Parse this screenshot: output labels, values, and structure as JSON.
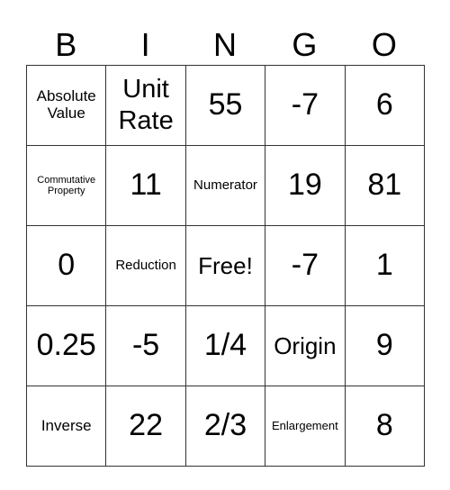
{
  "header": [
    "B",
    "I",
    "N",
    "G",
    "O"
  ],
  "rows": [
    [
      {
        "text": "Absolute Value",
        "size": "s-sm"
      },
      {
        "text": "Unit Rate",
        "size": "s-lg"
      },
      {
        "text": "55",
        "size": "s-xl"
      },
      {
        "text": "-7",
        "size": "s-xl"
      },
      {
        "text": "6",
        "size": "s-xl"
      }
    ],
    [
      {
        "text": "Commutative Property",
        "size": "s-tiny"
      },
      {
        "text": "11",
        "size": "s-xl"
      },
      {
        "text": "Numerator",
        "size": "s-xs"
      },
      {
        "text": "19",
        "size": "s-xl"
      },
      {
        "text": "81",
        "size": "s-xl"
      }
    ],
    [
      {
        "text": "0",
        "size": "s-xl"
      },
      {
        "text": "Reduction",
        "size": "s-xs"
      },
      {
        "text": "Free!",
        "size": "s-md"
      },
      {
        "text": "-7",
        "size": "s-xl"
      },
      {
        "text": "1",
        "size": "s-xl"
      }
    ],
    [
      {
        "text": "0.25",
        "size": "s-xl"
      },
      {
        "text": "-5",
        "size": "s-xl"
      },
      {
        "text": "1/4",
        "size": "s-xl"
      },
      {
        "text": "Origin",
        "size": "s-md"
      },
      {
        "text": "9",
        "size": "s-xl"
      }
    ],
    [
      {
        "text": "Inverse",
        "size": "s-sm"
      },
      {
        "text": "22",
        "size": "s-xl"
      },
      {
        "text": "2/3",
        "size": "s-xl"
      },
      {
        "text": "Enlargement",
        "size": "s-xxs"
      },
      {
        "text": "8",
        "size": "s-xl"
      }
    ]
  ]
}
